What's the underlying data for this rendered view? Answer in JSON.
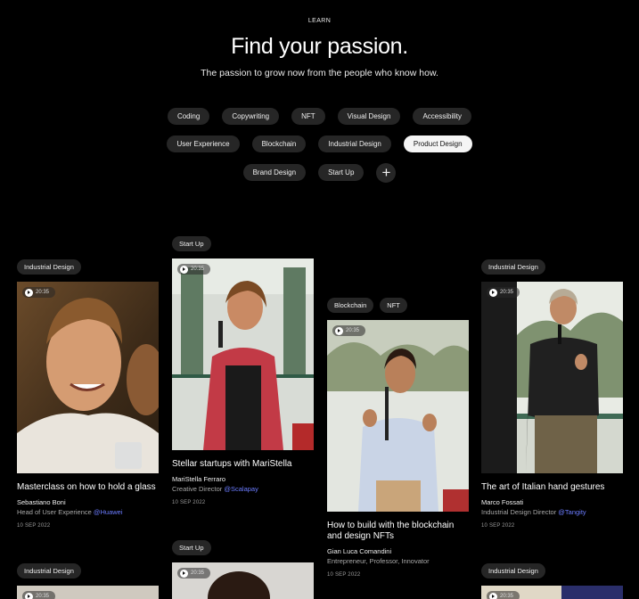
{
  "header": {
    "eyebrow": "LEARN",
    "title": "Find your passion.",
    "subtitle": "The passion to grow now from the people who know how."
  },
  "topics": {
    "row1": [
      "Coding",
      "Copywriting",
      "NFT",
      "Visual Design",
      "Accessibility"
    ],
    "row2": [
      "User Experience",
      "Blockchain",
      "Industrial Design",
      "Product Design"
    ],
    "row3": [
      "Brand Design",
      "Start Up"
    ],
    "selected": "Product Design",
    "more_icon": "plus-icon"
  },
  "cards": [
    {
      "tags": [
        "Industrial Design"
      ],
      "duration": "20:35",
      "title": "Masterclass on how to hold a glass",
      "speaker": "Sebastiano Boni",
      "role": "Head of User Experience",
      "company": "@Huawei",
      "date": "10 SEP 2022"
    },
    {
      "tags": [
        "Start Up"
      ],
      "duration": "20:35",
      "title": "Stellar startups with MariStella",
      "speaker": "MariStella Ferraro",
      "role": "Creative Director",
      "company": "@Scalapay",
      "date": "10 SEP 2022"
    },
    {
      "tags": [
        "Blockchain",
        "NFT"
      ],
      "duration": "20:35",
      "title": "How to build with the blockchain and design NFTs",
      "speaker": "Gian Luca Comandini",
      "role": "Entrepreneur, Professor, Innovator",
      "company": "",
      "date": "10 SEP 2022"
    },
    {
      "tags": [
        "Industrial Design"
      ],
      "duration": "20:35",
      "title": "The art of Italian hand gestures",
      "speaker": "Marco Fossati",
      "role": "Industrial Design Director",
      "company": "@Tangity",
      "date": "10 SEP 2022"
    }
  ],
  "next_cards": [
    {
      "tags": [
        "Industrial Design"
      ],
      "duration": "20:35"
    },
    {
      "tags": [
        "Start Up"
      ],
      "duration": "20:35"
    },
    {
      "tags": [
        "Industrial Design"
      ],
      "duration": "20:35"
    }
  ],
  "icons": {
    "play": "play-icon"
  }
}
